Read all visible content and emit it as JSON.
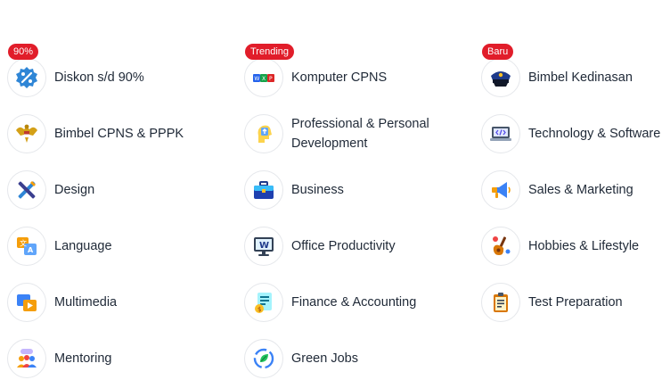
{
  "columns": [
    {
      "items": [
        {
          "label": "Diskon s/d 90%",
          "badge": "90%",
          "icon": "discount-icon"
        },
        {
          "label": "Bimbel CPNS & PPPK",
          "icon": "garuda-emblem-icon"
        },
        {
          "label": "Design",
          "icon": "design-tools-icon"
        },
        {
          "label": "Language",
          "icon": "language-translate-icon"
        },
        {
          "label": "Multimedia",
          "icon": "multimedia-icon"
        },
        {
          "label": "Mentoring",
          "icon": "mentoring-group-icon"
        }
      ]
    },
    {
      "items": [
        {
          "label": "Komputer CPNS",
          "badge": "Trending",
          "icon": "office-apps-icon"
        },
        {
          "label": "Professional & Personal Development",
          "icon": "personal-growth-icon"
        },
        {
          "label": "Business",
          "icon": "briefcase-icon"
        },
        {
          "label": "Office Productivity",
          "icon": "monitor-word-icon"
        },
        {
          "label": "Finance & Accounting",
          "icon": "finance-document-icon"
        },
        {
          "label": "Green Jobs",
          "icon": "green-recycle-icon"
        }
      ]
    },
    {
      "items": [
        {
          "label": "Bimbel Kedinasan",
          "badge": "Baru",
          "icon": "officer-cap-icon"
        },
        {
          "label": "Technology & Software",
          "icon": "laptop-code-icon"
        },
        {
          "label": "Sales & Marketing",
          "icon": "megaphone-icon"
        },
        {
          "label": "Hobbies & Lifestyle",
          "icon": "guitar-icon"
        },
        {
          "label": "Test Preparation",
          "icon": "clipboard-icon"
        }
      ]
    }
  ],
  "colors": {
    "badge": "#e11d2a",
    "border": "#e5e7eb",
    "text": "#1f2937"
  }
}
